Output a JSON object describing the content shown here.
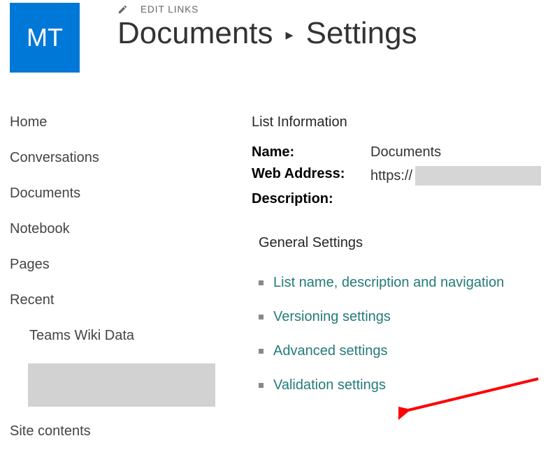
{
  "header": {
    "tile": "MT",
    "editLinks": "EDIT LINKS",
    "crumb1": "Documents",
    "sep": "▸",
    "crumb2": "Settings"
  },
  "nav": {
    "home": "Home",
    "conversations": "Conversations",
    "documents": "Documents",
    "notebook": "Notebook",
    "pages": "Pages",
    "recent": "Recent",
    "teamsWiki": "Teams Wiki Data",
    "siteContents": "Site contents"
  },
  "main": {
    "listInfoTitle": "List Information",
    "nameLabel": "Name:",
    "nameValue": "Documents",
    "webAddressLabel": "Web Address:",
    "webAddressValue": "https://",
    "descriptionLabel": "Description:",
    "generalSettings": "General Settings",
    "links": {
      "listName": "List name, description and navigation",
      "versioning": "Versioning settings",
      "advanced": "Advanced settings",
      "validation": "Validation settings"
    }
  }
}
